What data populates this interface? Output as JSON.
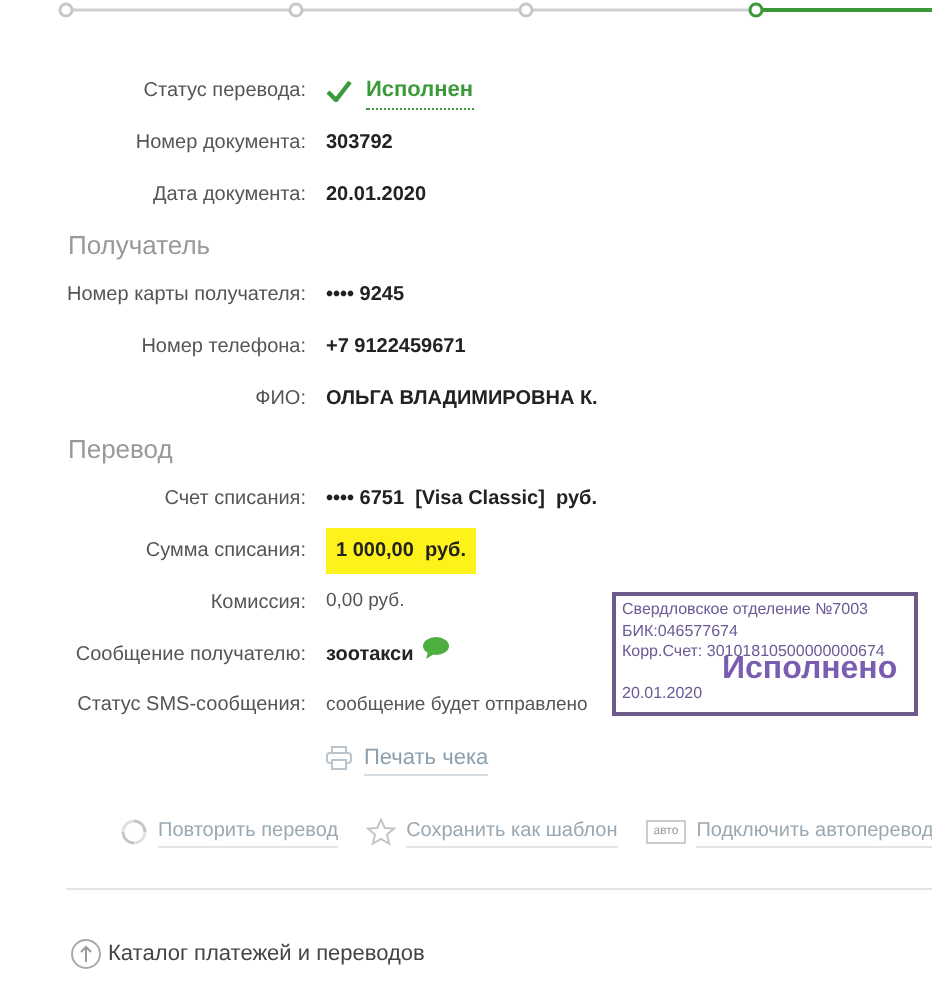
{
  "progress": {
    "steps": [
      {
        "selected": false
      },
      {
        "selected": false
      },
      {
        "selected": false
      },
      {
        "selected": true
      }
    ]
  },
  "header_rows": [
    {
      "label": "Статус перевода:",
      "value": "Исполнен",
      "kind": "status"
    },
    {
      "label": "Номер документа:",
      "value": "303792",
      "kind": "bold"
    },
    {
      "label": "Дата документа:",
      "value": "20.01.2020",
      "kind": "bold"
    }
  ],
  "sections": [
    {
      "title": "Получатель",
      "rows": [
        {
          "label": "Номер карты получателя:",
          "value": "•••• 9245",
          "kind": "bold"
        },
        {
          "label": "Номер телефона:",
          "value": "+7 9122459671",
          "kind": "bold"
        },
        {
          "label": "ФИО:",
          "value": "ОЛЬГА ВЛАДИМИРОВНА К.",
          "kind": "bold"
        }
      ]
    },
    {
      "title": "Перевод",
      "rows": [
        {
          "label": "Счет списания:",
          "value": "•••• 6751  [Visa Classic]  руб.",
          "kind": "bold"
        },
        {
          "label": "Сумма списания:",
          "value": "1 000,00  руб.",
          "kind": "highlight"
        },
        {
          "label": "Комиссия:",
          "value": "0,00 руб.",
          "kind": "plain"
        },
        {
          "label": "Сообщение получателю:",
          "value": "зоотакси",
          "kind": "sms"
        },
        {
          "label": "Статус SMS-сообщения:",
          "value": "сообщение будет отправлено",
          "kind": "plain"
        }
      ]
    }
  ],
  "print_link": "Печать чека",
  "actions": [
    {
      "label": "Повторить перевод",
      "kind": "repeat"
    },
    {
      "label": "Сохранить как шаблон",
      "kind": "star"
    },
    {
      "label": "Подключить автоперевод",
      "kind": "auto",
      "badge": "авто"
    }
  ],
  "catalog_link": "Каталог платежей и переводов",
  "stamp": {
    "lines": [
      "Свердловское отделение №7003",
      "БИК:046577674",
      "Корр.Счет: 30101810500000000674"
    ],
    "status": "Исполнено",
    "date": "20.01.2020"
  }
}
